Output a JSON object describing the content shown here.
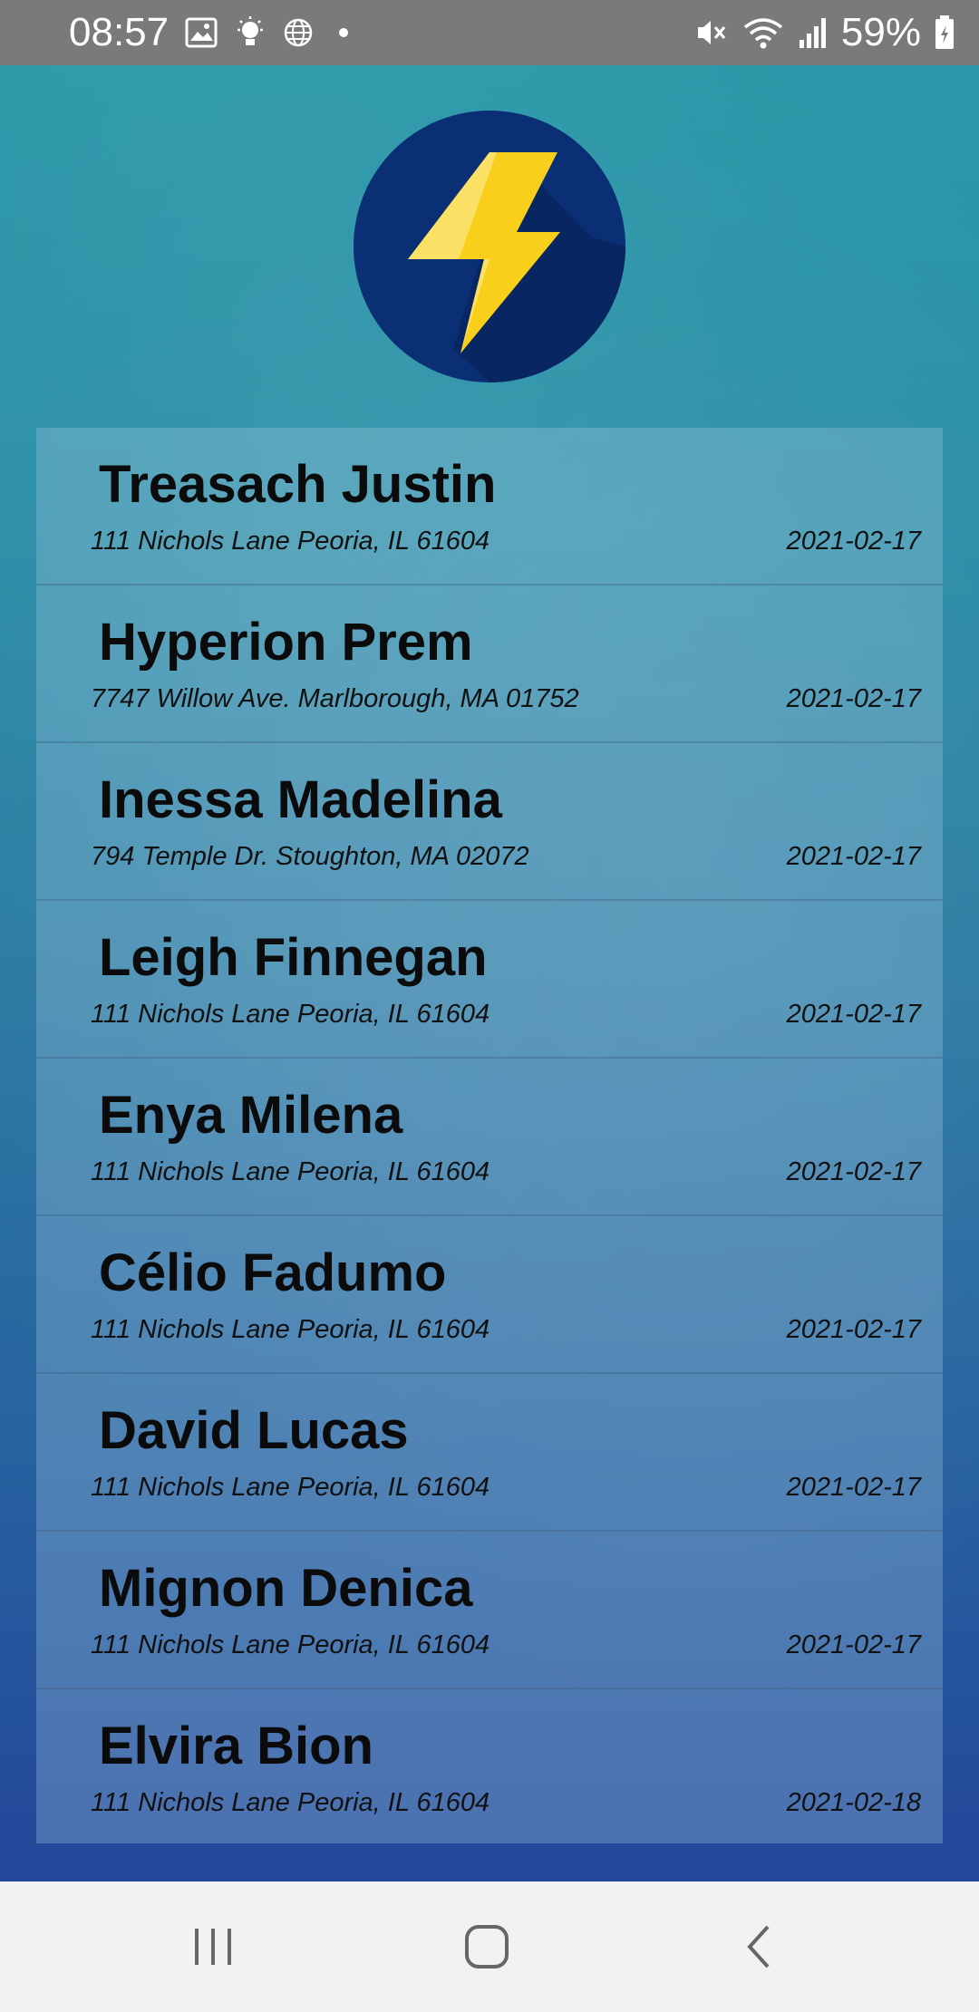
{
  "status_bar": {
    "time": "08:57",
    "battery_percent": "59%",
    "icons_left": [
      "image-icon",
      "lightbulb-icon",
      "globe-icon",
      "dot-icon"
    ],
    "icons_right": [
      "mute-icon",
      "wifi-icon",
      "signal-icon",
      "battery-icon"
    ]
  },
  "app": {
    "logo_icon": "lightning-bolt-icon",
    "colors": {
      "logo_circle": "#0a2f75",
      "bolt": "#f8cf1a"
    }
  },
  "contacts": [
    {
      "name": "Treasach Justin",
      "address": "111 Nichols Lane Peoria, IL 61604",
      "date": "2021-02-17"
    },
    {
      "name": "Hyperion Prem",
      "address": "7747 Willow Ave. Marlborough, MA 01752",
      "date": "2021-02-17"
    },
    {
      "name": "Inessa Madelina",
      "address": "794 Temple Dr. Stoughton, MA 02072",
      "date": "2021-02-17"
    },
    {
      "name": "Leigh Finnegan",
      "address": "111 Nichols Lane Peoria, IL 61604",
      "date": "2021-02-17"
    },
    {
      "name": "Enya Milena",
      "address": "111 Nichols Lane Peoria, IL 61604",
      "date": "2021-02-17"
    },
    {
      "name": "Célio Fadumo",
      "address": "111 Nichols Lane Peoria, IL 61604",
      "date": "2021-02-17"
    },
    {
      "name": "David Lucas",
      "address": "111 Nichols Lane Peoria, IL 61604",
      "date": "2021-02-17"
    },
    {
      "name": "Mignon Denica",
      "address": "111 Nichols Lane Peoria, IL 61604",
      "date": "2021-02-17"
    },
    {
      "name": "Elvira Bion",
      "address": "111 Nichols Lane Peoria, IL 61604",
      "date": "2021-02-18"
    }
  ],
  "nav_bar": {
    "icons": [
      "recent-apps-icon",
      "home-icon",
      "back-icon"
    ]
  }
}
